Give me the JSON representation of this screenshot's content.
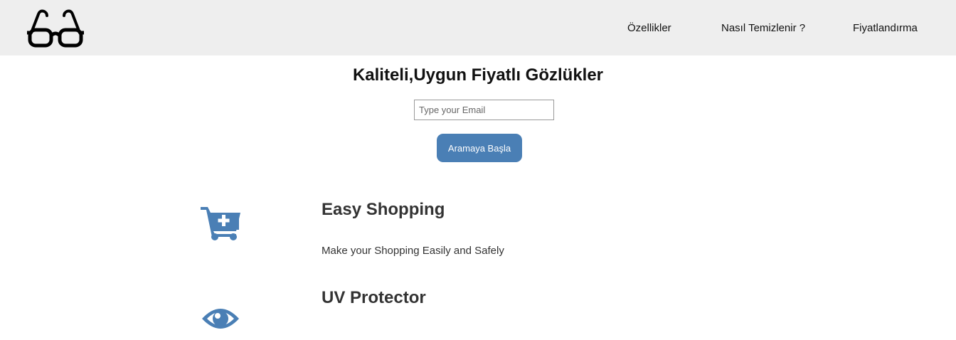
{
  "header": {
    "logo_icon": "glasses-icon",
    "nav": [
      {
        "label": "Özellikler"
      },
      {
        "label": "Nasıl Temizlenir ?"
      },
      {
        "label": "Fiyatlandırma"
      }
    ]
  },
  "hero": {
    "title": "Kaliteli,Uygun Fiyatlı Gözlükler",
    "email_placeholder": "Type your Email",
    "email_value": "",
    "button_label": "Aramaya Başla"
  },
  "features": [
    {
      "icon": "cart-plus-icon",
      "title": "Easy Shopping",
      "text": "Make your Shopping Easily and Safely"
    },
    {
      "icon": "eye-icon",
      "title": "UV Protector"
    }
  ],
  "colors": {
    "accent": "#4a7fb5",
    "header_bg": "#eeeeee",
    "text": "#222222"
  }
}
